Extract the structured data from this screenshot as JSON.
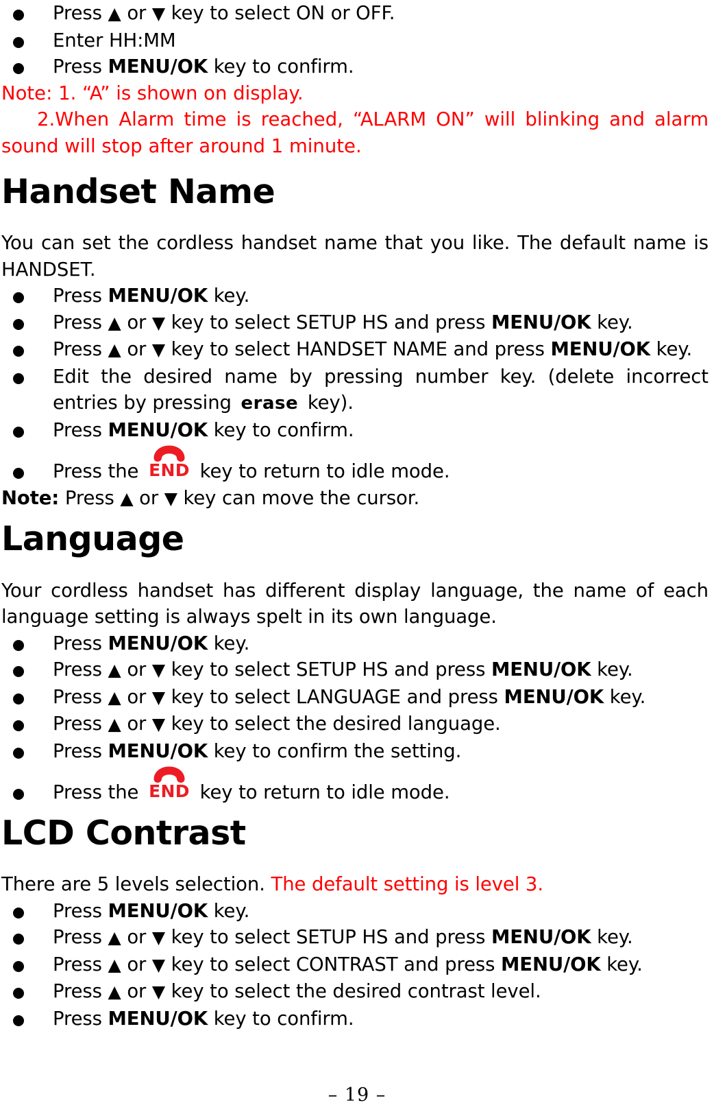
{
  "document": {
    "page_number": "– 19 –",
    "accent_red": "#ff0000",
    "icon_red": "#ed1c24"
  },
  "alarm_section": {
    "bullets": [
      {
        "pre": "Press ",
        "arrow_up": "▲",
        "mid": " or ",
        "arrow_down": "▼",
        "post": " key to select ON or OFF."
      },
      {
        "pre": "Enter HH:MM"
      },
      {
        "pre": "Press ",
        "bold": "MENU/OK",
        "post": " key to confirm."
      }
    ],
    "note_line1": "Note: 1. “A” is shown on display.",
    "note_line2": "2.When Alarm time is reached, “ALARM ON” will blinking and alarm sound will stop after around 1 minute."
  },
  "handset_name": {
    "heading": "Handset Name",
    "intro": "You can set the cordless handset name that you like. The default name is HANDSET.",
    "b1_pre": "Press ",
    "b1_bold": "MENU/OK",
    "b1_post": " key.",
    "b2_pre": "Press ",
    "b2_up": "▲",
    "b2_mid": " or ",
    "b2_down": "▼",
    "b2_post": " key to select SETUP HS and press ",
    "b2_bold2": "MENU/OK",
    "b2_tail": " key.",
    "b3_pre": "Press ",
    "b3_up": "▲",
    "b3_mid": " or ",
    "b3_down": "▼",
    "b3_post": " key to select HANDSET NAME and press ",
    "b3_bold2": "MENU/OK",
    "b3_tail": " key.",
    "b4_pre": "Edit the desired name by pressing number key. (delete incorrect entries by pressing ",
    "b4_key": "erase",
    "b4_post": " key).",
    "b5_pre": "Press ",
    "b5_bold": "MENU/OK",
    "b5_post": " key to confirm.",
    "b6_pre": "Press the ",
    "b6_key": "END",
    "b6_post": " key to return to idle mode.",
    "note_bold": "Note:",
    "note_pre": " Press ",
    "note_up": "▲",
    "note_mid": " or ",
    "note_down": "▼",
    "note_post": " key can move the cursor."
  },
  "language": {
    "heading": "Language",
    "intro": "Your cordless handset has different display language, the name of each language setting is always spelt in its own language.",
    "b1_pre": "Press ",
    "b1_bold": "MENU/OK",
    "b1_post": " key.",
    "b2_pre": "Press ",
    "b2_up": "▲",
    "b2_mid": " or ",
    "b2_down": "▼",
    "b2_post": " key to select SETUP HS and press ",
    "b2_bold2": "MENU/OK",
    "b2_tail": " key.",
    "b3_pre": "Press ",
    "b3_up": "▲",
    "b3_mid": " or ",
    "b3_down": "▼",
    "b3_post": " key to select LANGUAGE and press ",
    "b3_bold2": "MENU/OK",
    "b3_tail": " key.",
    "b4_pre": "Press ",
    "b4_up": "▲",
    "b4_mid": " or ",
    "b4_down": "▼",
    "b4_post": " key to select the desired language.",
    "b5_pre": "Press ",
    "b5_bold": "MENU/OK",
    "b5_post": " key to confirm the setting.",
    "b6_pre": "Press the ",
    "b6_key": "END",
    "b6_post": " key to return to idle mode."
  },
  "lcd_contrast": {
    "heading": "LCD Contrast",
    "intro_black": "There are 5 levels selection. ",
    "intro_red": "The default setting is level 3.",
    "b1_pre": "Press ",
    "b1_bold": "MENU/OK",
    "b1_post": " key.",
    "b2_pre": "Press ",
    "b2_up": "▲",
    "b2_mid": " or ",
    "b2_down": "▼",
    "b2_post": " key to select SETUP HS and press ",
    "b2_bold2": "MENU/OK",
    "b2_tail": " key.",
    "b3_pre": "Press ",
    "b3_up": "▲",
    "b3_mid": " or ",
    "b3_down": "▼",
    "b3_post": " key to select CONTRAST and press ",
    "b3_bold2": "MENU/OK",
    "b3_tail": " key.",
    "b4_pre": "Press ",
    "b4_up": "▲",
    "b4_mid": " or ",
    "b4_down": "▼",
    "b4_post": " key to select the desired contrast level.",
    "b5_pre": "Press ",
    "b5_bold": "MENU/OK",
    "b5_post": " key to confirm."
  }
}
